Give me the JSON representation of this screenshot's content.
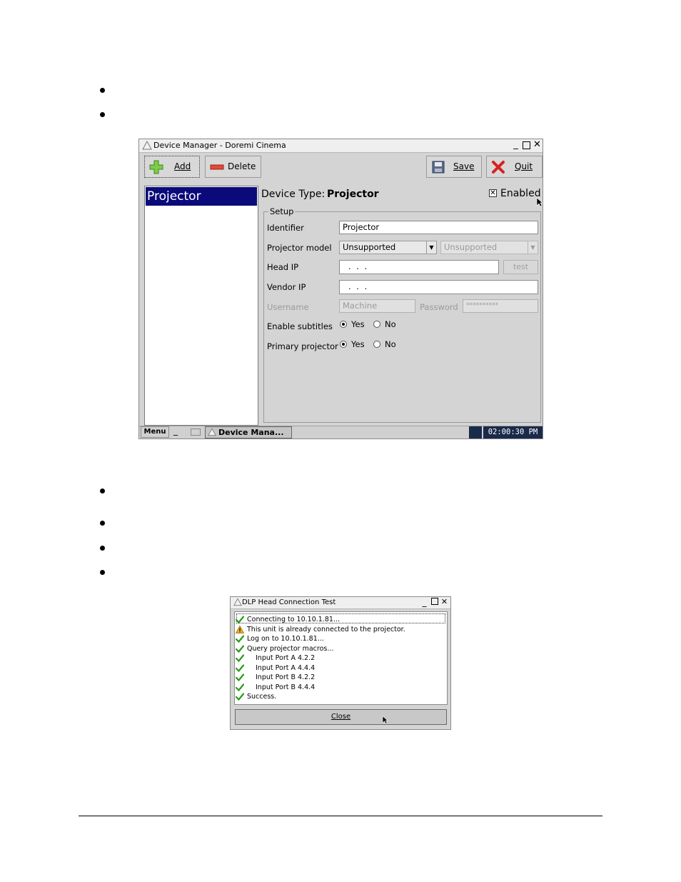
{
  "device_manager": {
    "title": "Device Manager - Doremi Cinema",
    "toolbar": {
      "add_label": "Add",
      "delete_label": "Delete",
      "save_label": "Save",
      "quit_label": "Quit"
    },
    "device_list": [
      "Projector"
    ],
    "device_type_label": "Device Type:",
    "device_type_value": "Projector",
    "enabled_label": "Enabled",
    "enabled_checked": true,
    "setup_group_label": "Setup",
    "fields": {
      "identifier_label": "Identifier",
      "identifier_value": "Projector",
      "projector_model_label": "Projector model",
      "projector_model_value": "Unsupported",
      "projector_model_secondary": "Unsupported",
      "head_ip_label": "Head IP",
      "head_ip_value": ". . .",
      "test_label": "test",
      "vendor_ip_label": "Vendor IP",
      "vendor_ip_value": ". . .",
      "username_label": "Username",
      "username_value": "Machine",
      "password_label": "Password",
      "password_value": "**********",
      "enable_subtitles_label": "Enable subtitles",
      "primary_projector_label": "Primary projector",
      "yes_label": "Yes",
      "no_label": "No"
    },
    "enable_subtitles_selected": "Yes",
    "primary_projector_selected": "Yes",
    "taskbar": {
      "menu_label": "Menu",
      "task_label": "Device Mana...",
      "clock": "02:00:30 PM"
    }
  },
  "dlp_dialog": {
    "title": "DLP Head Connection Test",
    "log": [
      {
        "icon": "check-icon",
        "text": "Connecting to 10.10.1.81...",
        "indent": false
      },
      {
        "icon": "warning-icon",
        "text": "This unit is already connected to the projector.",
        "indent": false
      },
      {
        "icon": "check-icon",
        "text": "Log on to 10.10.1.81...",
        "indent": false
      },
      {
        "icon": "check-icon",
        "text": "Query projector macros...",
        "indent": false
      },
      {
        "icon": "check-icon",
        "text": "Input Port A 4.2.2",
        "indent": true
      },
      {
        "icon": "check-icon",
        "text": "Input Port A 4.4.4",
        "indent": true
      },
      {
        "icon": "check-icon",
        "text": "Input Port B 4.2.2",
        "indent": true
      },
      {
        "icon": "check-icon",
        "text": "Input Port B 4.4.4",
        "indent": true
      },
      {
        "icon": "check-icon",
        "text": "Success.",
        "indent": false
      }
    ],
    "close_label": "Close"
  },
  "colors": {
    "selection": "#0a0a7a",
    "window_bg": "#d4d4d4",
    "check_green": "#2a9a1a"
  }
}
